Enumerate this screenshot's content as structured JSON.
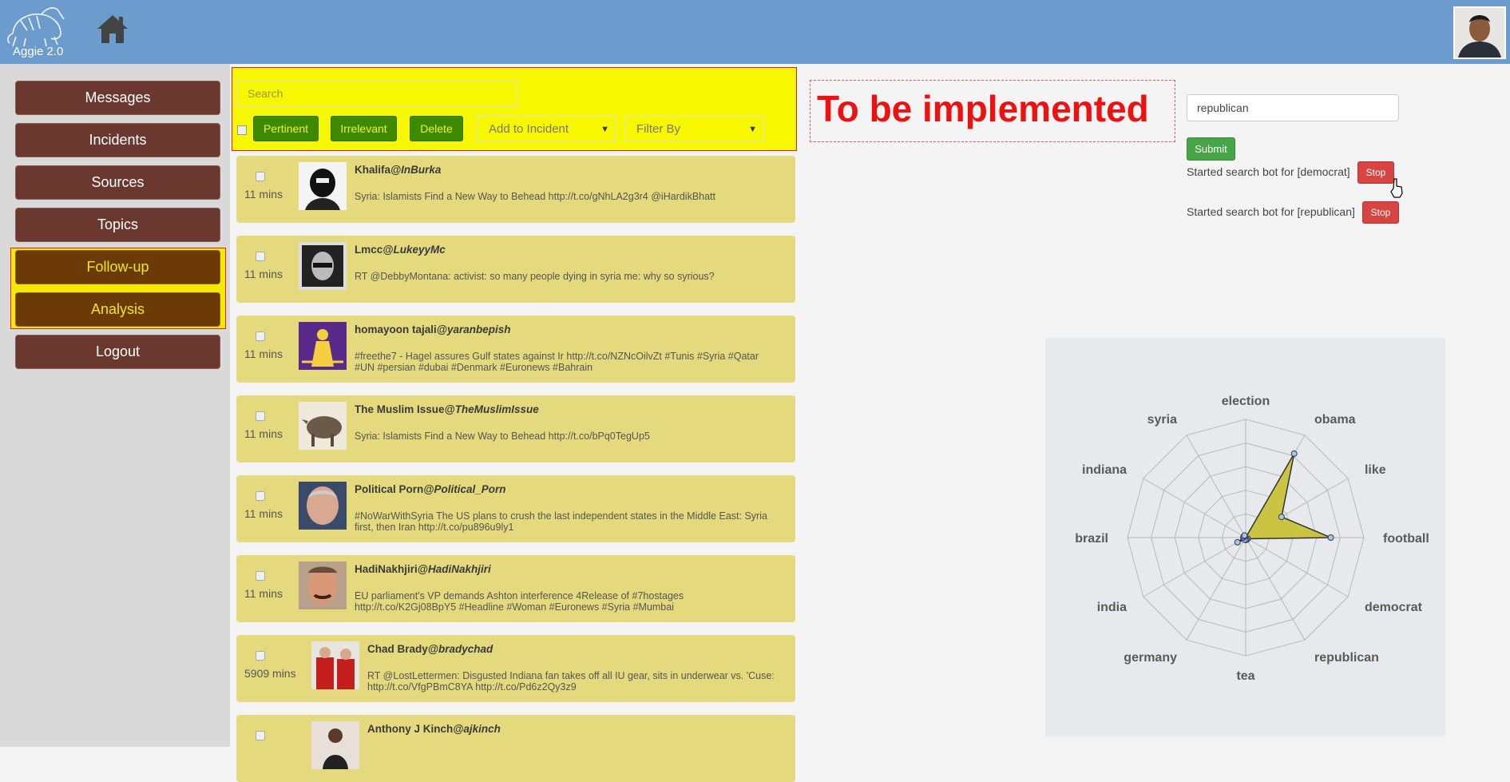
{
  "app": {
    "logo_text": "Aggie 2.0"
  },
  "sidebar": {
    "items": [
      {
        "label": "Messages"
      },
      {
        "label": "Incidents"
      },
      {
        "label": "Sources"
      },
      {
        "label": "Topics"
      },
      {
        "label": "Follow-up"
      },
      {
        "label": "Analysis"
      },
      {
        "label": "Logout"
      }
    ]
  },
  "toolbar": {
    "search_placeholder": "Search",
    "pertinent_label": "Pertinent",
    "irrelevant_label": "Irrelevant",
    "delete_label": "Delete",
    "add_to_incident": "Add to Incident",
    "filter_by": "Filter By"
  },
  "messages": [
    {
      "time": "11 mins",
      "name": "Khalifa",
      "handle": "@InBurka",
      "text": "Syria: Islamists Find a New Way to Behead http://t.co/gNhLA2g3r4 @iHardikBhatt"
    },
    {
      "time": "11 mins",
      "name": "Lmcc",
      "handle": "@LukeyyMc",
      "text": "RT @DebbyMontana: activist: so many people dying in syria me: why so syrious?"
    },
    {
      "time": "11 mins",
      "name": "homayoon tajali",
      "handle": "@yaranbepish",
      "text": "#freethe7 - Hagel assures Gulf states against Ir http://t.co/NZNcOilvZt #Tunis #Syria #Qatar #UN #persian #dubai #Denmark #Euronews #Bahrain"
    },
    {
      "time": "11 mins",
      "name": "The Muslim Issue",
      "handle": "@TheMuslimIssue",
      "text": "Syria: Islamists Find a New Way to Behead http://t.co/bPq0TegUp5"
    },
    {
      "time": "11 mins",
      "name": "Political Porn",
      "handle": "@Political_Porn",
      "text": "#NoWarWithSyria The US plans to crush the last independent states in the Middle East: Syria first, then Iran http://t.co/pu896u9ly1"
    },
    {
      "time": "11 mins",
      "name": "HadiNakhjiri",
      "handle": "@HadiNakhjiri",
      "text": "EU parliament's VP demands Ashton interference 4Release of #7hostages http://t.co/K2Gj08BpY5 #Headline #Woman #Euronews #Syria #Mumbai"
    },
    {
      "time": "5909 mins",
      "name": "Chad Brady",
      "handle": "@bradychad",
      "text": "RT @LostLettermen: Disgusted Indiana fan takes off all IU gear, sits in underwear vs. 'Cuse: http://t.co/VfgPBmC8YA http://t.co/Pd6z2Qy3z9"
    },
    {
      "time": "",
      "name": "Anthony J Kinch",
      "handle": "@ajkinch",
      "text": ""
    }
  ],
  "placeholder_panel": {
    "text": "To be implemented"
  },
  "search_bot": {
    "keyword_value": "republican",
    "submit_label": "Submit",
    "bots": [
      {
        "text": "Started search bot for [democrat]",
        "stop_label": "Stop"
      },
      {
        "text": "Started search bot for [republican]",
        "stop_label": "Stop"
      }
    ]
  },
  "chart_data": {
    "type": "radar",
    "categories": [
      "election",
      "obama",
      "like",
      "football",
      "democrat",
      "republican",
      "tea",
      "germany",
      "india",
      "brazil",
      "indiana",
      "syria"
    ],
    "values": [
      0.0,
      0.82,
      0.35,
      0.72,
      0.02,
      0.02,
      0.02,
      0.02,
      0.08,
      0.02,
      0.02,
      0.02
    ],
    "rmax": 1.0,
    "rings": 5,
    "fill_color": "#c9c23a",
    "stroke_color": "#333333"
  }
}
